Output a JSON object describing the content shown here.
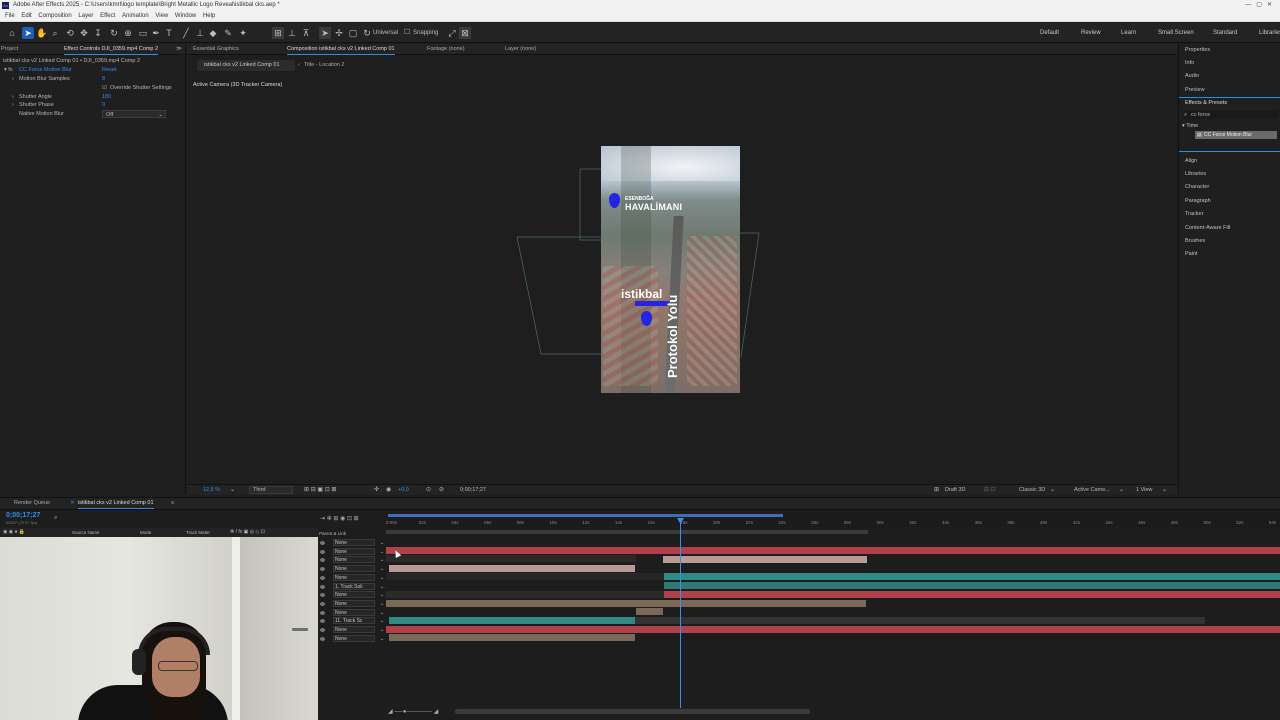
{
  "window": {
    "title": "Adobe After Effects 2025 - C:\\Users\\kmrl\\logo template\\Bright Metallic Logo Reveal\\istikbal cks.aep *"
  },
  "menu": [
    "File",
    "Edit",
    "Composition",
    "Layer",
    "Effect",
    "Animation",
    "View",
    "Window",
    "Help"
  ],
  "toolbar": {
    "universal": "Universal",
    "snapping": "Snapping",
    "workspaces": [
      "Default",
      "Review",
      "Learn",
      "Small Screen",
      "Standard",
      "Libraries"
    ]
  },
  "left_panel": {
    "tabs": [
      "Project",
      "Effect Controls DJI_0359.mp4 Comp 2"
    ],
    "subtitle": "istikbal cks v2 Linked Comp 01 • DJI_0359.mp4 Comp 2",
    "effect_name": "CC Force Motion Blur",
    "reset": "Reset",
    "rows": [
      {
        "label": "Motion Blur Samples",
        "value": "8"
      },
      {
        "label": "Override Shutter Settings",
        "value": ""
      },
      {
        "label": "Shutter Angle",
        "value": "180"
      },
      {
        "label": "Shutter Phase",
        "value": "0"
      },
      {
        "label": "Native Motion Blur",
        "value": "Off"
      }
    ]
  },
  "comp_panel": {
    "tabs": [
      "Essential Graphics",
      "Composition istikbal cks v2 Linked Comp 01",
      "Footage (none)",
      "Layer (none)"
    ],
    "subtabs": [
      "istikbal cks v2 Linked Comp 01",
      "Title - Location 2"
    ],
    "active_camera": "Active Camera (3D Tracker Camera)",
    "frame_text": {
      "line1": "ESENBOĞA",
      "line2": "HAVALİMANI",
      "istikbal": "istikbal",
      "protokol": "Protokol Yolu"
    },
    "bottom": {
      "zoom": "12,5 %",
      "resolution": "Third",
      "exposure": "+0,0",
      "timecode": "0;00;17;27",
      "draft3d": "Draft 3D",
      "renderer": "Classic 3D",
      "camera": "Active Came...",
      "view": "1 View"
    }
  },
  "right_panel": {
    "items": [
      "Properties",
      "Info",
      "Audio",
      "Preview",
      "Effects & Presets",
      "Align",
      "Libraries",
      "Character",
      "Paragraph",
      "Tracker",
      "Content-Aware Fill",
      "Brushes",
      "Paint"
    ],
    "search": "cc force",
    "tree_folder": "Time",
    "tree_item": "CC Force Motion Blur"
  },
  "timeline": {
    "tabs": [
      "Render Queue",
      "istikbal cks v2 Linked Comp 01"
    ],
    "timecode": "0;00;17;27",
    "timecode_sub": "00537 (29.97 fps)",
    "columns": [
      "Source Name",
      "Mode",
      "Track Matte",
      "Parent & Link"
    ],
    "ticks": [
      "0:00s",
      "02s",
      "04s",
      "06s",
      "08s",
      "10s",
      "12s",
      "14s",
      "16s",
      "18s",
      "20s",
      "22s",
      "24s",
      "26s",
      "28s",
      "30s",
      "32s",
      "34s",
      "36s",
      "38s",
      "40s",
      "42s",
      "44s",
      "46s",
      "48s",
      "50s",
      "52s",
      "54s"
    ],
    "parents": [
      "None",
      "None",
      "None",
      "None",
      "None",
      "1. Track Soli",
      "None",
      "None",
      "None",
      "11. Track Sc",
      "None",
      "None"
    ]
  },
  "colors": {
    "accent": "#2d8ceb",
    "playhead": "#3f8ee0",
    "red_bar": "#b0404a",
    "teal_bar": "#2f8a85",
    "tan_bar": "#7a6a55",
    "pink_bar": "#b89a95"
  }
}
